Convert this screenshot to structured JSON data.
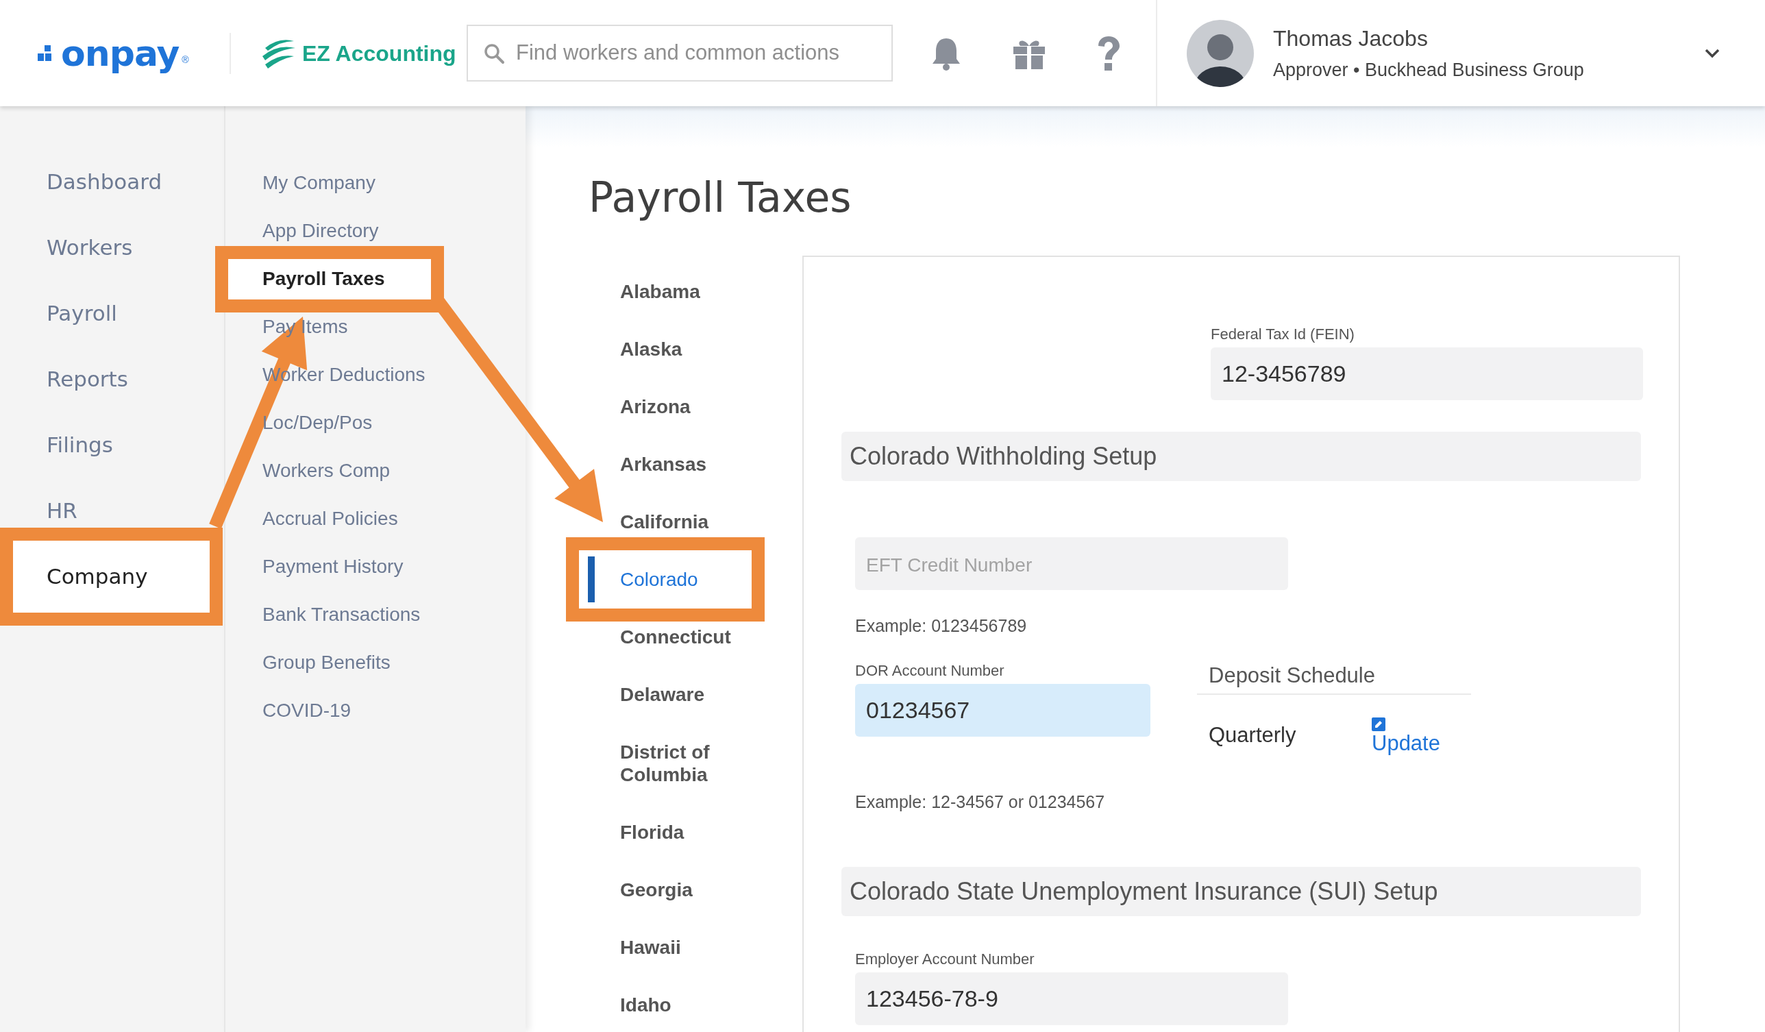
{
  "header": {
    "logo": {
      "text": "onpay",
      "mark": "®"
    },
    "app_logo": {
      "text": "EZ Accounting"
    },
    "search": {
      "placeholder": "Find workers and common actions"
    },
    "user": {
      "name": "Thomas Jacobs",
      "role": "Approver • Buckhead Business Group"
    }
  },
  "main_nav": [
    {
      "label": "Dashboard",
      "selected": false,
      "highlighted": false
    },
    {
      "label": "Workers",
      "selected": false,
      "highlighted": false
    },
    {
      "label": "Payroll",
      "selected": false,
      "highlighted": false
    },
    {
      "label": "Reports",
      "selected": false,
      "highlighted": false
    },
    {
      "label": "Filings",
      "selected": false,
      "highlighted": false
    },
    {
      "label": "HR",
      "selected": false,
      "highlighted": false
    },
    {
      "label": "Company",
      "selected": true,
      "highlighted": true
    }
  ],
  "sub_nav": [
    {
      "label": "My Company",
      "selected": false,
      "highlighted": false
    },
    {
      "label": "App Directory",
      "selected": false,
      "highlighted": false
    },
    {
      "label": "Payroll Taxes",
      "selected": true,
      "highlighted": true
    },
    {
      "label": "Pay Items",
      "selected": false,
      "highlighted": false
    },
    {
      "label": "Worker Deductions",
      "selected": false,
      "highlighted": false
    },
    {
      "label": "Loc/Dep/Pos",
      "selected": false,
      "highlighted": false
    },
    {
      "label": "Workers Comp",
      "selected": false,
      "highlighted": false
    },
    {
      "label": "Accrual Policies",
      "selected": false,
      "highlighted": false
    },
    {
      "label": "Payment History",
      "selected": false,
      "highlighted": false
    },
    {
      "label": "Bank Transactions",
      "selected": false,
      "highlighted": false
    },
    {
      "label": "Group Benefits",
      "selected": false,
      "highlighted": false
    },
    {
      "label": "COVID-19",
      "selected": false,
      "highlighted": false
    }
  ],
  "page_title": "Payroll Taxes",
  "states": [
    {
      "label": "Alabama",
      "selected": false,
      "highlighted": false
    },
    {
      "label": "Alaska",
      "selected": false,
      "highlighted": false
    },
    {
      "label": "Arizona",
      "selected": false,
      "highlighted": false
    },
    {
      "label": "Arkansas",
      "selected": false,
      "highlighted": false
    },
    {
      "label": "California",
      "selected": false,
      "highlighted": false
    },
    {
      "label": "Colorado",
      "selected": true,
      "highlighted": true
    },
    {
      "label": "Connecticut",
      "selected": false,
      "highlighted": false
    },
    {
      "label": "Delaware",
      "selected": false,
      "highlighted": false
    },
    {
      "label": "District of Columbia",
      "selected": false,
      "highlighted": false
    },
    {
      "label": "Florida",
      "selected": false,
      "highlighted": false
    },
    {
      "label": "Georgia",
      "selected": false,
      "highlighted": false
    },
    {
      "label": "Hawaii",
      "selected": false,
      "highlighted": false
    },
    {
      "label": "Idaho",
      "selected": false,
      "highlighted": false
    }
  ],
  "form": {
    "fein": {
      "label": "Federal Tax Id (FEIN)",
      "value": "12-3456789"
    },
    "withholding": {
      "title": "Colorado Withholding Setup",
      "eft": {
        "placeholder": "EFT Credit Number",
        "example": "Example: 0123456789"
      },
      "dor": {
        "label": "DOR Account Number",
        "value": "01234567",
        "focused": true,
        "example": "Example: 12-34567 or 01234567"
      },
      "deposit": {
        "title": "Deposit Schedule",
        "value": "Quarterly",
        "action": "Update"
      }
    },
    "sui": {
      "title": "Colorado State Unemployment Insurance (SUI) Setup",
      "employer": {
        "label": "Employer Account Number",
        "value": "123456-78-9"
      }
    }
  }
}
